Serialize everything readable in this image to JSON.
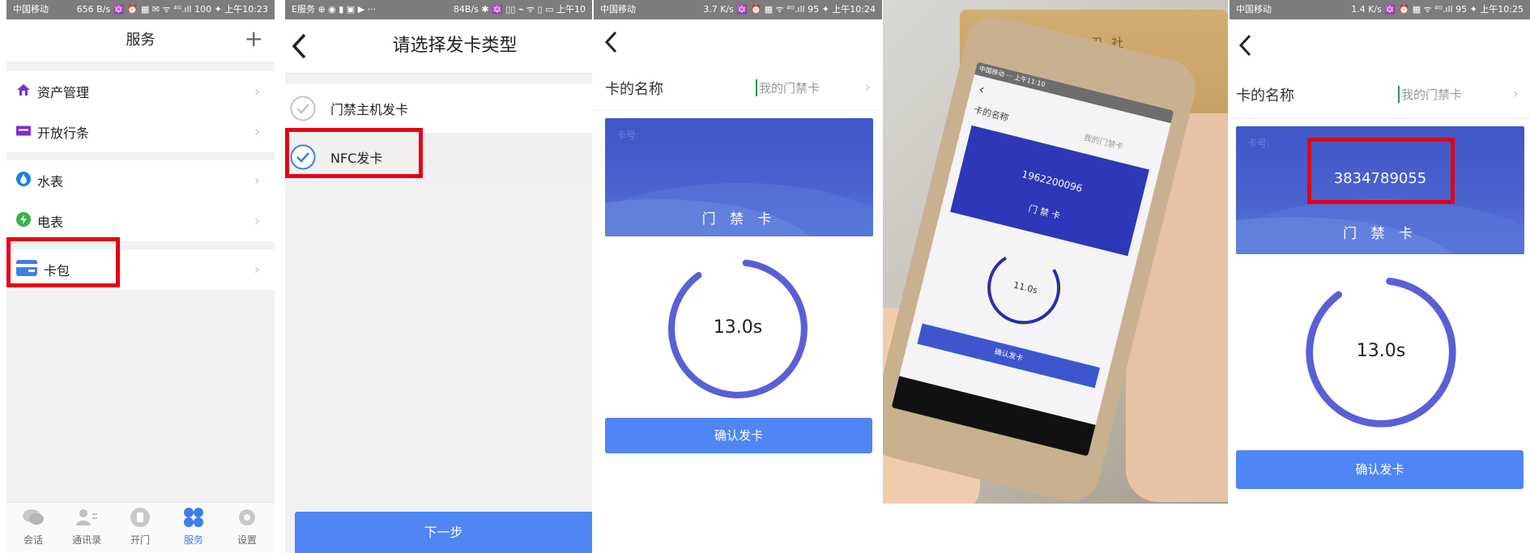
{
  "panel1": {
    "status_left": "中国移动",
    "status_right": "656 B/s 🔯 ⏰ ▦ ✉ ᯤ ⁴ᴳ.ıll 100 ✦ 上午10:23",
    "title": "服务",
    "add_label": "+",
    "items": [
      {
        "label": "资产管理"
      },
      {
        "label": "开放行条"
      },
      {
        "label": "水表"
      },
      {
        "label": "电表"
      },
      {
        "label": "卡包"
      }
    ],
    "tabs": [
      {
        "label": "会话"
      },
      {
        "label": "通讯录"
      },
      {
        "label": "开门"
      },
      {
        "label": "服务"
      },
      {
        "label": "设置"
      }
    ],
    "accent": "#3f7de8"
  },
  "panel2": {
    "status_left": "E服务 ⊕ ◉ ▮ ▣ ▶ ···",
    "status_right": "84B/s ✱ 🔯 ▯▯ ⌁ ᯤ ▯ ▭ 上午10",
    "title": "请选择发卡类型",
    "options": [
      {
        "label": "门禁主机发卡",
        "selected": false
      },
      {
        "label": "NFC发卡",
        "selected": true
      }
    ],
    "next_label": "下一步"
  },
  "panel3": {
    "status_left": "中国移动",
    "status_right": "3.7 K/s 🔯 ⏰ ▦ ᯤ ⁴ᴳ.ıll 95 ✦ 上午10:24",
    "name_label": "卡的名称",
    "name_value": "我的门禁卡",
    "card_no_label": "卡号:",
    "card_type": "门 禁 卡",
    "timer": "13.0s",
    "timer_progress": 0.88,
    "confirm_label": "确认发卡"
  },
  "photo": {
    "top_card_text": "< < <   新 卡 一 卫 社",
    "screen_name_label": "卡的名称",
    "screen_name_value": "我的门禁卡",
    "screen_card_number": "1962200096",
    "screen_card_type": "门 禁 卡",
    "screen_timer": "11.0s",
    "screen_confirm": "确认发卡",
    "screen_status": "中国移动 ··· 上午11:10"
  },
  "panel5": {
    "status_left": "中国移动",
    "status_right": "1.4 K/s 🔯 ⏰ ▦ ᯤ ⁴ᴳ.ıll 95 ✦ 上午10:25",
    "name_label": "卡的名称",
    "name_value": "我的门禁卡",
    "card_no_label": "卡号:",
    "card_number": "3834789055",
    "card_type": "门 禁 卡",
    "timer": "13.0s",
    "timer_progress": 0.88,
    "confirm_label": "确认发卡"
  }
}
